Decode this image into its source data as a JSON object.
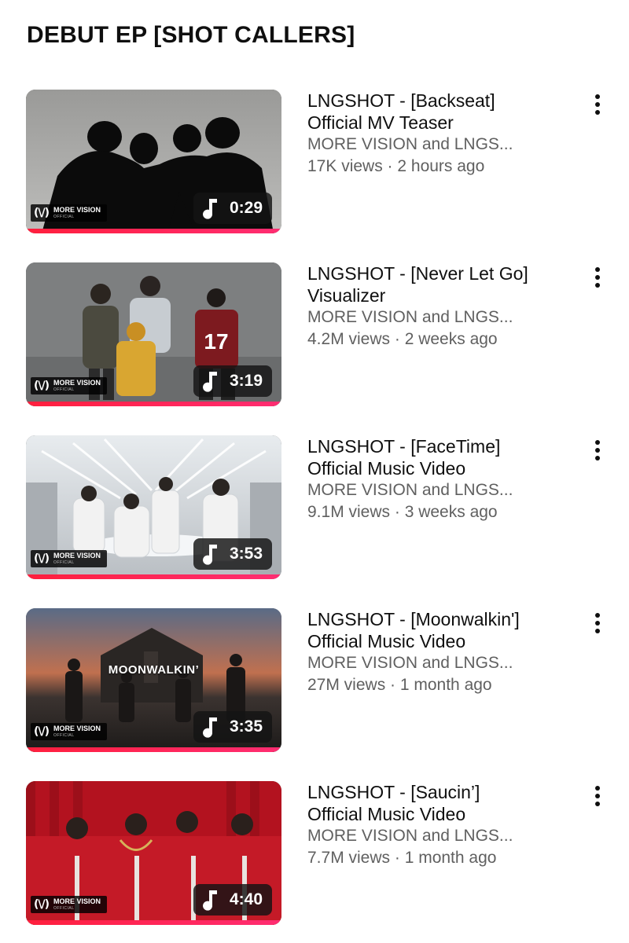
{
  "playlist": {
    "title": "DEBUT EP [SHOT CALLERS]"
  },
  "brand": {
    "logo": "(\\/)",
    "name": "MORE VISION",
    "sub": "OFFICIAL"
  },
  "colors": {
    "progress": "#ff1f3d",
    "secondary_text": "#606060",
    "primary_text": "#0f0f0f"
  },
  "icons": {
    "duration": "music-note-icon",
    "menu": "more-vert-icon"
  },
  "videos": [
    {
      "title_line1": "LNGSHOT - [Backseat]",
      "title_line2": "Official MV Teaser",
      "channel": "MORE VISION and LNGS...",
      "meta": "17K views · 2 hours ago",
      "duration": "0:29",
      "thumb_caption": ""
    },
    {
      "title_line1": "LNGSHOT - [Never Let Go]",
      "title_line2": "Visualizer",
      "channel": "MORE VISION and LNGS...",
      "meta": "4.2M views · 2 weeks ago",
      "duration": "3:19",
      "thumb_caption": ""
    },
    {
      "title_line1": "LNGSHOT - [FaceTime]",
      "title_line2": "Official Music Video",
      "channel": "MORE VISION and LNGS...",
      "meta": "9.1M views · 3 weeks ago",
      "duration": "3:53",
      "thumb_caption": ""
    },
    {
      "title_line1": "LNGSHOT - [Moonwalkin']",
      "title_line2": "Official Music Video",
      "channel": "MORE VISION and LNGS...",
      "meta": "27M views · 1 month ago",
      "duration": "3:35",
      "thumb_caption": "MOONWALKIN’"
    },
    {
      "title_line1": "LNGSHOT - [Saucin’]",
      "title_line2": "Official Music Video",
      "channel": "MORE VISION and LNGS...",
      "meta": "7.7M views · 1 month ago",
      "duration": "4:40",
      "thumb_caption": ""
    }
  ]
}
